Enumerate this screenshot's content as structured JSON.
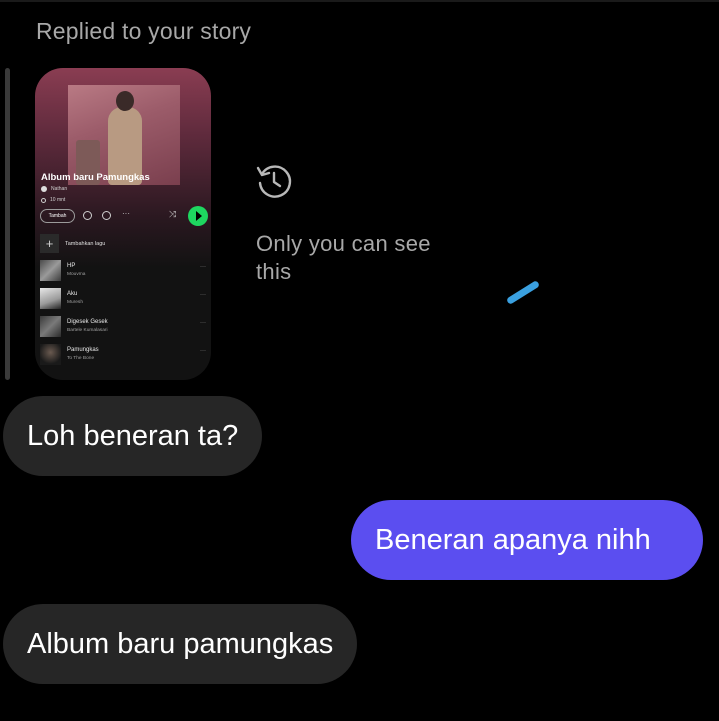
{
  "header": {
    "replied_label": "Replied to your story"
  },
  "story": {
    "album_title": "Album baru Pamungkas",
    "owner": "Nathan",
    "duration": "10 mnt",
    "follow_label": "Tambah",
    "more_label": "···",
    "add_song_label": "Tambahkan lagu",
    "tracks": [
      {
        "title": "HP",
        "artist": "Mouvma"
      },
      {
        "title": "Aku",
        "artist": "Muresh"
      },
      {
        "title": "Digesek Gesek",
        "artist": "Bartele Kumalasari"
      },
      {
        "title": "Pamungkas",
        "artist": "To The Bone"
      }
    ],
    "track_more": "···"
  },
  "notice": {
    "text": "Only you can see this",
    "icon": "history-icon"
  },
  "messages": [
    {
      "direction": "incoming",
      "text": "Loh beneran ta?"
    },
    {
      "direction": "outgoing",
      "text": "Beneran apanya nihh"
    },
    {
      "direction": "incoming",
      "text": "Album baru pamungkas"
    }
  ],
  "colors": {
    "background": "#000000",
    "incoming_bubble": "#262626",
    "outgoing_bubble": "#5b4ef0",
    "muted_text": "#a8a8a8",
    "play_green": "#1ed760",
    "spinner_blue": "#3aa0e0"
  }
}
